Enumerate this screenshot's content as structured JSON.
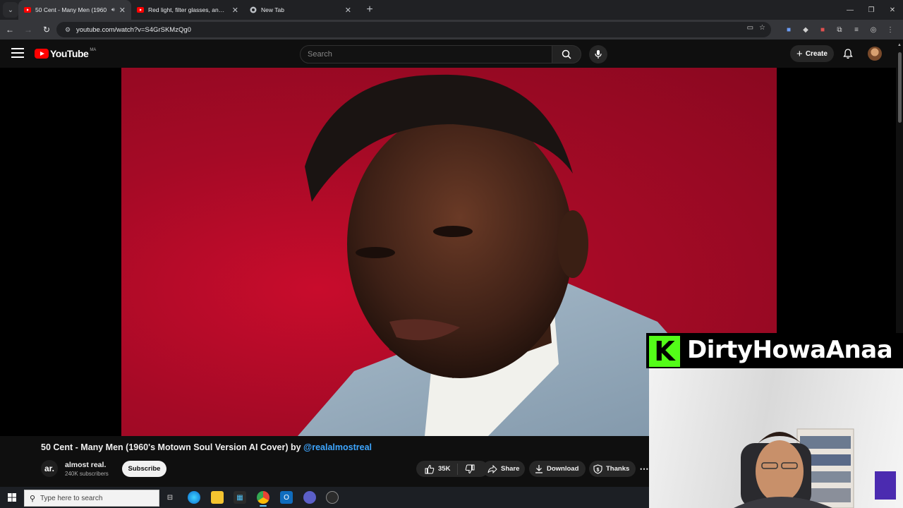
{
  "browser": {
    "tabs": [
      {
        "title": "50 Cent - Many Men (1960",
        "favicon": "youtube-icon",
        "active": true,
        "audio": true
      },
      {
        "title": "Red light, filter glasses, and but",
        "favicon": "youtube-icon",
        "active": false
      },
      {
        "title": "New Tab",
        "favicon": "chrome-icon",
        "active": false
      }
    ],
    "url": "youtube.com/watch?v=S4GrSKMzQg0"
  },
  "youtube": {
    "logo_text": "YouTube",
    "country_code": "MA",
    "search_placeholder": "Search",
    "create_label": "Create"
  },
  "video": {
    "title": "50 Cent - Many Men (1960's Motown Soul Version AI Cover) by ",
    "title_handle": "@realalmostreal",
    "channel_avatar_text": "ar.",
    "channel_name": "almost real.",
    "subscribers": "240K subscribers",
    "subscribe_label": "Subscribe",
    "likes": "35K",
    "share_label": "Share",
    "download_label": "Download",
    "thanks_label": "Thanks"
  },
  "overlay": {
    "platform_letter": "K",
    "streamer_name": "DirtyHowaAnaa"
  },
  "taskbar": {
    "search_placeholder": "Type here to search"
  },
  "colors": {
    "youtube_red": "#ff0000",
    "link_blue": "#3ea6ff",
    "kick_green": "#53fc18",
    "video_background": "#b00a26"
  }
}
